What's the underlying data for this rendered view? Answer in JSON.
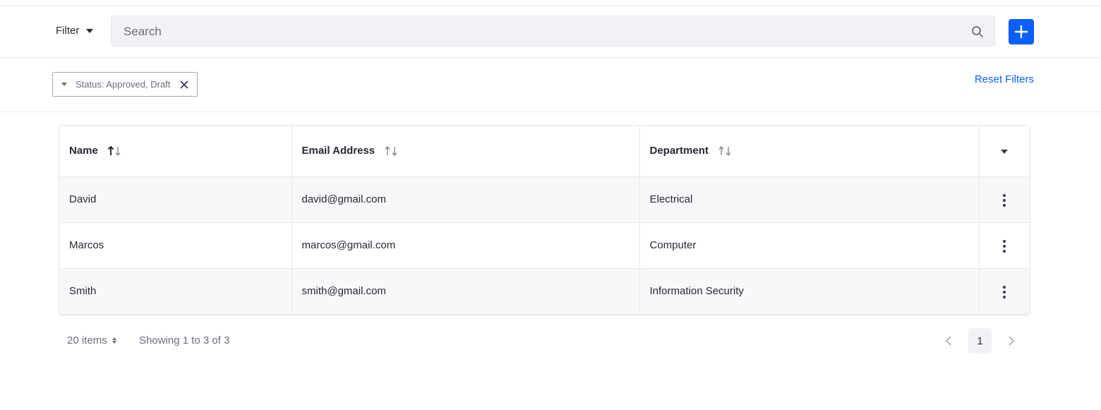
{
  "toolbar": {
    "filter_label": "Filter",
    "search_placeholder": "Search",
    "add_icon": "plus-icon"
  },
  "filters": {
    "chip_label": "Status: Approved, Draft",
    "reset_label": "Reset Filters"
  },
  "table": {
    "columns": [
      {
        "label": "Name",
        "sort": "ascending"
      },
      {
        "label": "Email Address",
        "sort": "none"
      },
      {
        "label": "Department",
        "sort": "none"
      }
    ],
    "rows": [
      {
        "name": "David",
        "email": "david@gmail.com",
        "department": "Electrical"
      },
      {
        "name": "Marcos",
        "email": "marcos@gmail.com",
        "department": "Computer"
      },
      {
        "name": "Smith",
        "email": "smith@gmail.com",
        "department": "Information Security"
      }
    ]
  },
  "pagination": {
    "per_page": "20 items",
    "showing": "Showing 1 to 3 of 3",
    "current_page": "1"
  },
  "colors": {
    "primary": "#0b5fff",
    "border": "#e7e7ed",
    "row_alt": "#f7f8f9"
  }
}
